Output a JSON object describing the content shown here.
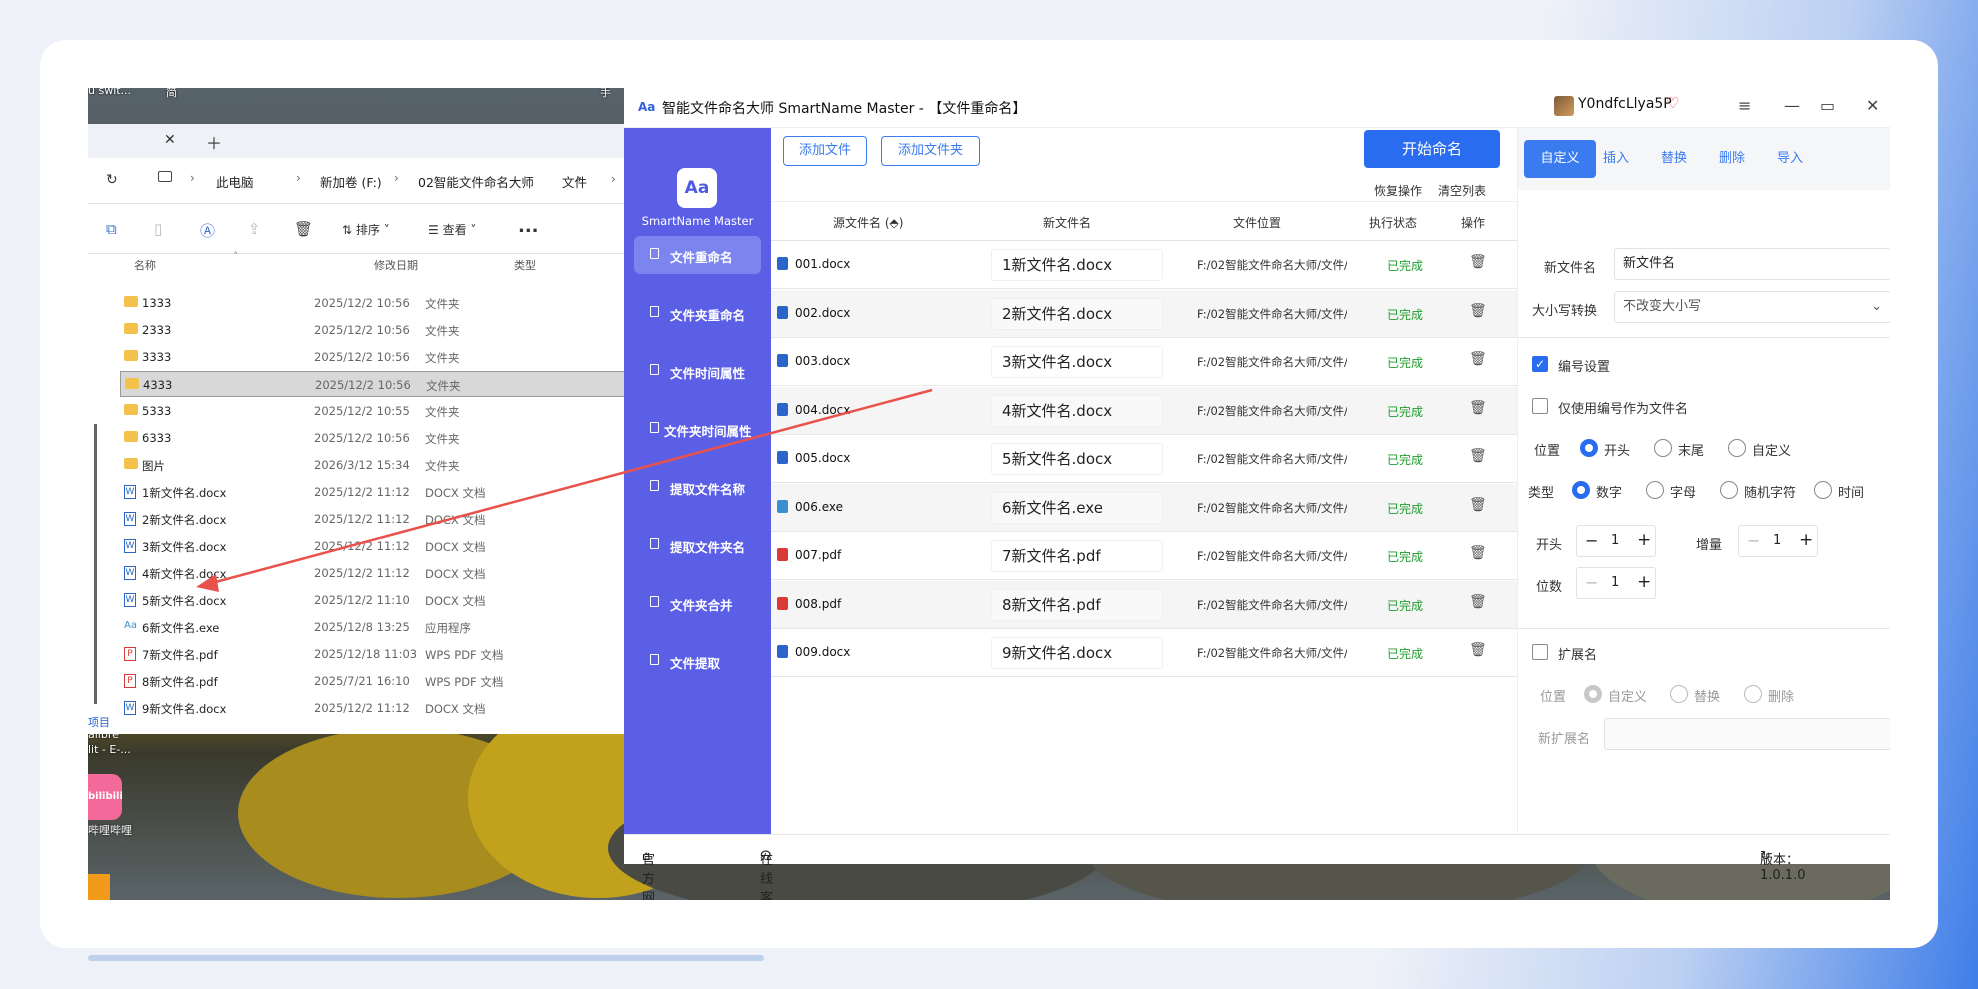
{
  "desktop": {
    "top_left": "u swit...",
    "top_mid": "简",
    "top_right": "手",
    "items": [
      "项目",
      "alibre",
      "lit - E-..."
    ],
    "bilibili": "bilibili",
    "bilibili_label": "哔哩哔哩"
  },
  "explorer": {
    "breadcrumb": [
      "此电脑",
      "新加卷 (F:)",
      "02智能文件命名大师",
      "文件"
    ],
    "toolbar": {
      "sort": "排序",
      "view": "查看",
      "more": "..."
    },
    "columns": [
      "名称",
      "修改日期",
      "类型"
    ],
    "rows": [
      {
        "name": "1333",
        "date": "2025/12/2 10:56",
        "type": "文件夹",
        "kind": "folder"
      },
      {
        "name": "2333",
        "date": "2025/12/2 10:56",
        "type": "文件夹",
        "kind": "folder"
      },
      {
        "name": "3333",
        "date": "2025/12/2 10:56",
        "type": "文件夹",
        "kind": "folder"
      },
      {
        "name": "4333",
        "date": "2025/12/2 10:56",
        "type": "文件夹",
        "kind": "folder"
      },
      {
        "name": "5333",
        "date": "2025/12/2 10:55",
        "type": "文件夹",
        "kind": "folder"
      },
      {
        "name": "6333",
        "date": "2025/12/2 10:56",
        "type": "文件夹",
        "kind": "folder"
      },
      {
        "name": "图片",
        "date": "2026/3/12 15:34",
        "type": "文件夹",
        "kind": "folder"
      },
      {
        "name": "1新文件名.docx",
        "date": "2025/12/2 11:12",
        "type": "DOCX 文档",
        "kind": "docx"
      },
      {
        "name": "2新文件名.docx",
        "date": "2025/12/2 11:12",
        "type": "DOCX 文档",
        "kind": "docx"
      },
      {
        "name": "3新文件名.docx",
        "date": "2025/12/2 11:12",
        "type": "DOCX 文档",
        "kind": "docx"
      },
      {
        "name": "4新文件名.docx",
        "date": "2025/12/2 11:12",
        "type": "DOCX 文档",
        "kind": "docx"
      },
      {
        "name": "5新文件名.docx",
        "date": "2025/12/2 11:10",
        "type": "DOCX 文档",
        "kind": "docx"
      },
      {
        "name": "6新文件名.exe",
        "date": "2025/12/8 13:25",
        "type": "应用程序",
        "kind": "exe"
      },
      {
        "name": "7新文件名.pdf",
        "date": "2025/12/18 11:03",
        "type": "WPS PDF 文档",
        "kind": "pdf"
      },
      {
        "name": "8新文件名.pdf",
        "date": "2025/7/21 16:10",
        "type": "WPS PDF 文档",
        "kind": "pdf"
      },
      {
        "name": "9新文件名.docx",
        "date": "2025/12/2 11:12",
        "type": "DOCX 文档",
        "kind": "docx"
      }
    ],
    "selected_index": 3
  },
  "app": {
    "title": "智能文件命名大师 SmartName Master - 【文件重命名】",
    "user": "Y0ndfcLlya5P",
    "brand": "SmartName Master",
    "nav": [
      "文件重命名",
      "文件夹重命名",
      "文件时间属性",
      "文件夹时间属性",
      "提取文件名称",
      "提取文件夹名",
      "文件夹合并",
      "文件提取"
    ],
    "add_file": "添加文件",
    "add_folder": "添加文件夹",
    "start": "开始命名",
    "undo": "恢复操作",
    "clear": "清空列表",
    "columns": [
      "源文件名 (⬘)",
      "新文件名",
      "文件位置",
      "执行状态",
      "操作"
    ],
    "rows": [
      {
        "src": "001.docx",
        "new": "1新文件名.docx",
        "loc": "F:/02智能文件命名大师/文件/",
        "status": "已完成",
        "kind": "docx"
      },
      {
        "src": "002.docx",
        "new": "2新文件名.docx",
        "loc": "F:/02智能文件命名大师/文件/",
        "status": "已完成",
        "kind": "docx"
      },
      {
        "src": "003.docx",
        "new": "3新文件名.docx",
        "loc": "F:/02智能文件命名大师/文件/",
        "status": "已完成",
        "kind": "docx"
      },
      {
        "src": "004.docx",
        "new": "4新文件名.docx",
        "loc": "F:/02智能文件命名大师/文件/",
        "status": "已完成",
        "kind": "docx"
      },
      {
        "src": "005.docx",
        "new": "5新文件名.docx",
        "loc": "F:/02智能文件命名大师/文件/",
        "status": "已完成",
        "kind": "docx"
      },
      {
        "src": "006.exe",
        "new": "6新文件名.exe",
        "loc": "F:/02智能文件命名大师/文件/",
        "status": "已完成",
        "kind": "exe"
      },
      {
        "src": "007.pdf",
        "new": "7新文件名.pdf",
        "loc": "F:/02智能文件命名大师/文件/",
        "status": "已完成",
        "kind": "pdf"
      },
      {
        "src": "008.pdf",
        "new": "8新文件名.pdf",
        "loc": "F:/02智能文件命名大师/文件/",
        "status": "已完成",
        "kind": "pdf"
      },
      {
        "src": "009.docx",
        "new": "9新文件名.docx",
        "loc": "F:/02智能文件命名大师/文件/",
        "status": "已完成",
        "kind": "docx"
      }
    ],
    "right": {
      "tabs": [
        "自定义",
        "插入",
        "替换",
        "删除",
        "导入"
      ],
      "new_name_label": "新文件名",
      "new_name_value": "新文件名",
      "case_label": "大小写转换",
      "case_value": "不改变大小写",
      "numbering": "编号设置",
      "only_number": "仅使用编号作为文件名",
      "position_label": "位置",
      "position_opts": [
        "开头",
        "末尾",
        "自定义"
      ],
      "type_label": "类型",
      "type_opts": [
        "数字",
        "字母",
        "随机字符",
        "时间"
      ],
      "start_label": "开头",
      "start_value": "1",
      "inc_label": "增量",
      "inc_value": "1",
      "digits_label": "位数",
      "digits_value": "1",
      "ext": "扩展名",
      "ext_pos_label": "位置",
      "ext_pos_opts": [
        "自定义",
        "替换",
        "删除"
      ],
      "ext_new_label": "新扩展名"
    },
    "footer": {
      "site": "官方网站",
      "service": "在线客服",
      "version": "版本：1.0.1.0"
    }
  },
  "colors": {
    "sidebar": "#5b5fe6",
    "accent": "#2a6cf0",
    "done": "#1f9d2d",
    "arrow": "#e8524a"
  }
}
